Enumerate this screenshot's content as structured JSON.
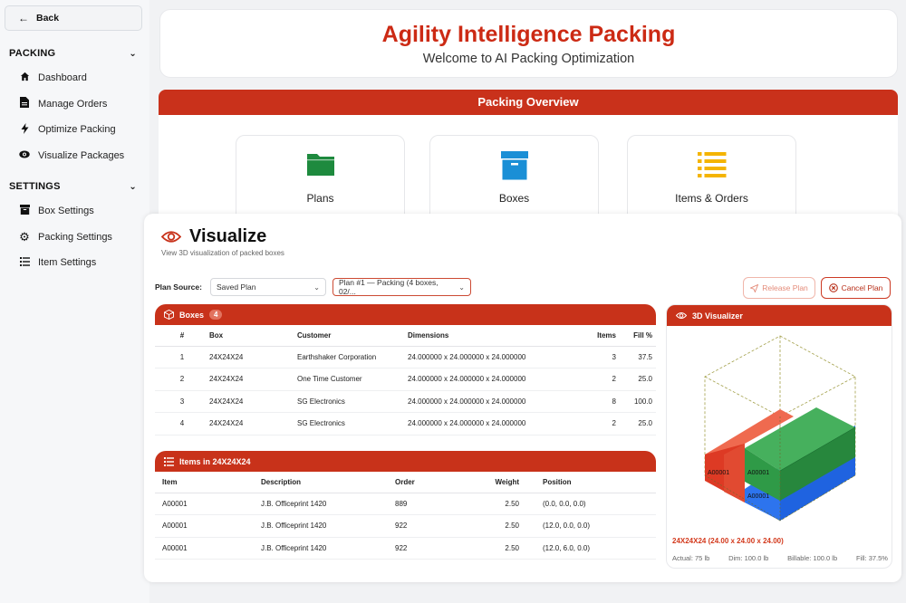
{
  "sidebar": {
    "back_label": "Back",
    "sections": [
      {
        "label": "PACKING",
        "items": [
          {
            "label": "Dashboard",
            "icon": "home-icon"
          },
          {
            "label": "Manage Orders",
            "icon": "document-icon"
          },
          {
            "label": "Optimize Packing",
            "icon": "bolt-icon"
          },
          {
            "label": "Visualize Packages",
            "icon": "eye-icon"
          }
        ]
      },
      {
        "label": "SETTINGS",
        "items": [
          {
            "label": "Box Settings",
            "icon": "box-icon"
          },
          {
            "label": "Packing Settings",
            "icon": "gear-icon"
          },
          {
            "label": "Item Settings",
            "icon": "list-icon"
          }
        ]
      }
    ]
  },
  "header": {
    "title": "Agility Intelligence Packing",
    "subtitle": "Welcome to AI Packing Optimization"
  },
  "overview": {
    "title": "Packing Overview",
    "cards": [
      {
        "label": "Plans",
        "icon": "folder-icon",
        "color": "#1e8a3e"
      },
      {
        "label": "Boxes",
        "icon": "box-icon",
        "color": "#1a8fd6"
      },
      {
        "label": "Items & Orders",
        "icon": "list-icon",
        "color": "#f4b400"
      }
    ]
  },
  "visualize": {
    "title": "Visualize",
    "subtitle": "View 3D visualization of packed boxes",
    "plan_source_label": "Plan Source:",
    "plan_source_value": "Saved Plan",
    "plan_value": "Plan #1 — Packing (4 boxes, 02/...",
    "release_label": "Release Plan",
    "cancel_label": "Cancel Plan"
  },
  "boxes": {
    "title": "Boxes",
    "count": "4",
    "columns": [
      "#",
      "Box",
      "Customer",
      "Dimensions",
      "Items",
      "Fill %"
    ],
    "rows": [
      [
        "1",
        "24X24X24",
        "Earthshaker Corporation",
        "24.000000 x 24.000000 x 24.000000",
        "3",
        "37.5"
      ],
      [
        "2",
        "24X24X24",
        "One Time Customer",
        "24.000000 x 24.000000 x 24.000000",
        "2",
        "25.0"
      ],
      [
        "3",
        "24X24X24",
        "SG Electronics",
        "24.000000 x 24.000000 x 24.000000",
        "8",
        "100.0"
      ],
      [
        "4",
        "24X24X24",
        "SG Electronics",
        "24.000000 x 24.000000 x 24.000000",
        "2",
        "25.0"
      ]
    ]
  },
  "items": {
    "title": "Items in 24X24X24",
    "columns": [
      "Item",
      "Description",
      "Order",
      "Weight",
      "Position"
    ],
    "rows": [
      [
        "A00001",
        "J.B. Officeprint 1420",
        "889",
        "2.50",
        "(0.0, 0.0, 0.0)"
      ],
      [
        "A00001",
        "J.B. Officeprint 1420",
        "922",
        "2.50",
        "(12.0, 0.0, 0.0)"
      ],
      [
        "A00001",
        "J.B. Officeprint 1420",
        "922",
        "2.50",
        "(12.0, 6.0, 0.0)"
      ]
    ]
  },
  "visualizer": {
    "title": "3D Visualizer",
    "labels": [
      "A00001",
      "A00001",
      "A00001"
    ],
    "dims": "24X24X24 (24.00 x 24.00 x 24.00)",
    "actual": "Actual: 75 lb",
    "dim": "Dim: 100.0 lb",
    "billable": "Billable: 100.0 lb",
    "fill": "Fill: 37.5%"
  }
}
